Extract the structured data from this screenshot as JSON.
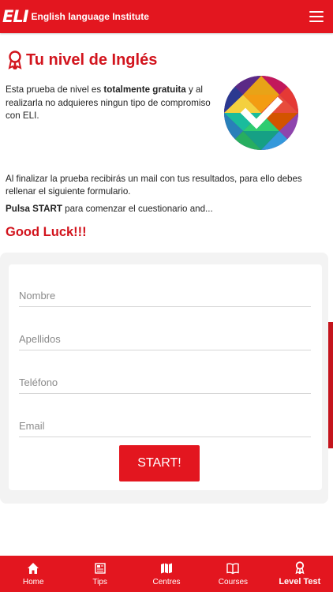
{
  "header": {
    "logo_mark": "ELI",
    "logo_text": "English language Institute",
    "menu_icon": "hamburger-icon"
  },
  "page": {
    "title": "Tu nivel de Inglés",
    "title_icon": "award-icon",
    "intro_1": "Esta prueba de nivel es ",
    "intro_bold": "totalmente gratuita",
    "intro_2": " y al realizarla no adquieres ningun tipo de compromiso con ELI.",
    "para2": "Al finalizar la prueba recibirás un mail con tus resultados, para ello debes rellenar el siguiente formulario.",
    "para3_bold": "Pulsa START",
    "para3_rest": " para comenzar el cuestionario and...",
    "good_luck": "Good Luck!!!"
  },
  "form": {
    "nombre_placeholder": "Nombre",
    "apellidos_placeholder": "Apellidos",
    "telefono_placeholder": "Teléfono",
    "email_placeholder": "Email",
    "start_label": "START!"
  },
  "tabbar": {
    "items": [
      {
        "label": "Home",
        "icon": "home-icon"
      },
      {
        "label": "Tips",
        "icon": "newspaper-icon"
      },
      {
        "label": "Centres",
        "icon": "map-icon"
      },
      {
        "label": "Courses",
        "icon": "book-icon"
      },
      {
        "label": "Level Test",
        "icon": "award-icon"
      }
    ],
    "active": "Level Test"
  },
  "colors": {
    "brand_red": "#e3161f",
    "title_red": "#d2141d"
  }
}
